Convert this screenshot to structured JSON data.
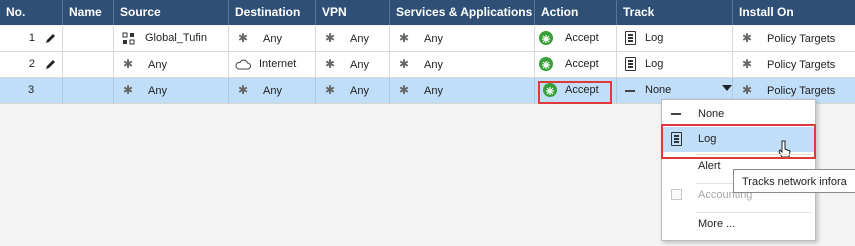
{
  "columns": [
    "No.",
    "Name",
    "Source",
    "Destination",
    "VPN",
    "Services & Applications",
    "Action",
    "Track",
    "Install On"
  ],
  "rows": [
    {
      "no": "1",
      "name": "",
      "source": "Global_Tufin",
      "destination": "Any",
      "vpn": "Any",
      "services": "Any",
      "action": "Accept",
      "track": "Log",
      "install_on": "Policy Targets"
    },
    {
      "no": "2",
      "name": "",
      "source": "Any",
      "destination": "Internet",
      "vpn": "Any",
      "services": "Any",
      "action": "Accept",
      "track": "Log",
      "install_on": "Policy Targets"
    },
    {
      "no": "3",
      "name": "",
      "source": "Any",
      "destination": "Any",
      "vpn": "Any",
      "services": "Any",
      "action": "Accept",
      "track": "None",
      "install_on": "Policy Targets"
    }
  ],
  "track_menu": {
    "items": [
      {
        "label": "None",
        "state": "normal"
      },
      {
        "label": "Log",
        "state": "hover"
      },
      {
        "label": "Alert",
        "state": "normal"
      },
      {
        "label": "Accounting",
        "state": "disabled"
      },
      {
        "label": "More ...",
        "state": "normal"
      }
    ]
  },
  "tooltip": "Tracks network infora",
  "colors": {
    "header_bg": "#2f4f76",
    "selected_row": "#c0def7",
    "highlight": "#e0383b",
    "accept": "#37a137"
  }
}
